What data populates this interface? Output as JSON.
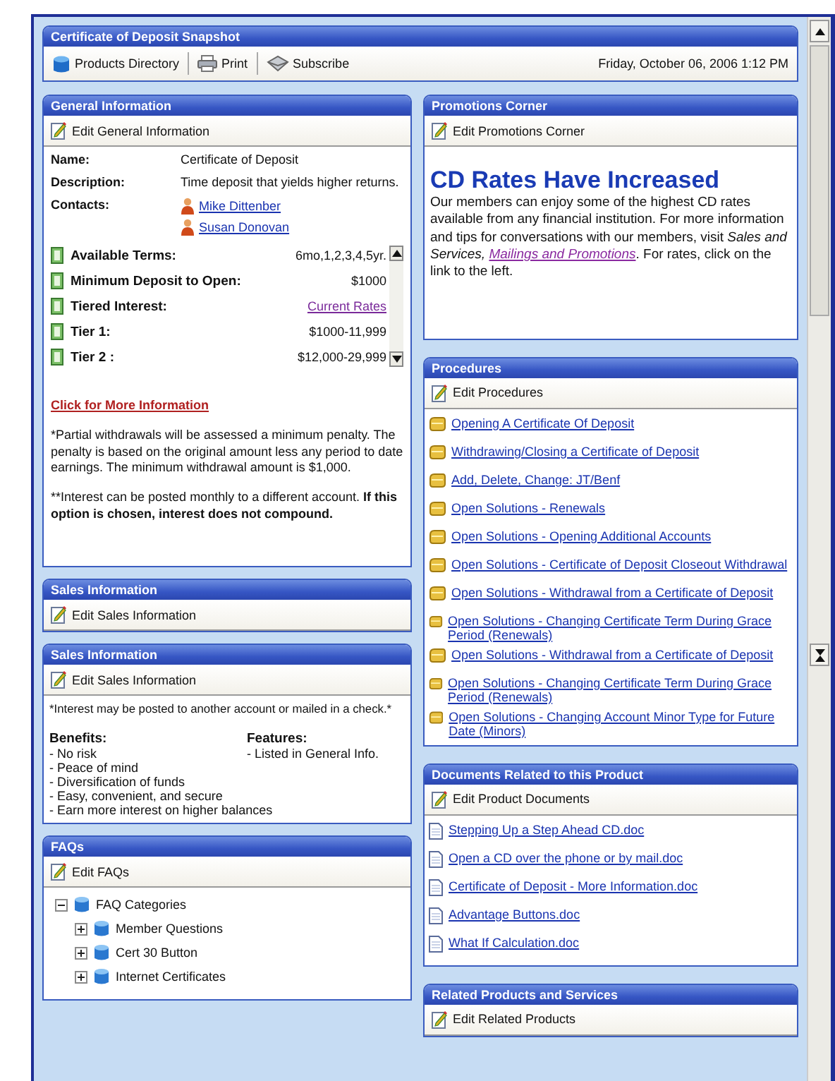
{
  "header": {
    "title": "Certificate of Deposit Snapshot",
    "toolbar": [
      {
        "kind": "directory",
        "label": "Products Directory"
      },
      {
        "kind": "print",
        "label": "Print"
      },
      {
        "kind": "subscribe",
        "label": "Subscribe"
      }
    ],
    "date": "Friday, October 06, 2006 1:12 PM"
  },
  "left_column": [
    {
      "kind": "general",
      "title": "General Information",
      "edit_label": "Edit General Information",
      "fields": [
        {
          "label": "Name:",
          "value": "Certificate of Deposit"
        },
        {
          "label": "Description:",
          "value": "Time deposit that yields higher returns."
        }
      ],
      "contacts_label": "Contacts:",
      "contacts": [
        "Mike Dittenber",
        "Susan Donovan"
      ],
      "terms": [
        {
          "kind": "text",
          "label": "Available Terms:",
          "value": "6mo,1,2,3,4,5yr."
        },
        {
          "kind": "text",
          "label": "Minimum Deposit to Open:",
          "value": "$1000"
        },
        {
          "kind": "link",
          "label": "Tiered Interest:",
          "value": "Current Rates"
        },
        {
          "kind": "text",
          "label": "Tier 1:",
          "value": "$1000-11,999"
        },
        {
          "kind": "text",
          "label": "Tier 2 :",
          "value": "$12,000-29,999"
        }
      ],
      "more_link": "Click for More Information",
      "note": "*Partial withdrawals will be assessed a minimum penalty.  The penalty is based on the original amount less any period to date earnings. The minimum withdrawal amount is $1,000.",
      "note2": {
        "text": "**Interest can be posted monthly to a different account.",
        "emphasis": "If this option is chosen, interest does not compound."
      }
    },
    {
      "kind": "empty",
      "title": "Sales Information",
      "edit_label": "Edit Sales Information"
    },
    {
      "kind": "sales",
      "title": "Sales Information",
      "edit_label": "Edit Sales Information",
      "note": "*Interest may be posted to another account or mailed in a check.*",
      "lists": [
        {
          "heading": "Benefits:",
          "items": [
            "- No risk",
            "- Peace of mind",
            "- Diversification of funds",
            "- Easy, convenient, and secure",
            "- Earn more interest on higher balances"
          ]
        },
        {
          "heading": "Features:",
          "items": [
            "- Listed in General Info."
          ]
        }
      ]
    },
    {
      "kind": "tree",
      "title": "FAQs",
      "edit_label": "Edit FAQs",
      "tree": {
        "label": "FAQ Categories",
        "expanded": true,
        "children": [
          {
            "label": "Member Questions",
            "expanded": false
          },
          {
            "label": "Cert 30 Button",
            "expanded": false
          },
          {
            "label": "Internet Certificates",
            "expanded": false
          }
        ]
      }
    }
  ],
  "right_column": [
    {
      "kind": "promo",
      "title": "Promotions Corner",
      "edit_label": "Edit Promotions Corner",
      "heading": "CD Rates Have Increased",
      "text_before": "Our members can enjoy some of the highest CD rates available from any financial institution. For more information and tips for conversations with our members, visit *Sales and Services,*",
      "link": "Mailings and Promotions",
      "text_after": ". For rates, click on the link to the left."
    },
    {
      "kind": "procedures",
      "title": "Procedures",
      "edit_label": "Edit Procedures",
      "links": [
        "Opening A Certificate Of Deposit",
        "Withdrawing/Closing a Certificate of Deposit",
        "Add, Delete, Change: JT/Benf",
        "Open Solutions - Renewals",
        "Open Solutions - Opening Additional Accounts",
        "Open Solutions - Certificate of Deposit Closeout Withdrawal",
        "Open Solutions - Withdrawal from a Certificate of Deposit",
        "Open Solutions - Changing Certificate Term During Grace Period (Renewals)",
        "Open Solutions - Withdrawal from a Certificate of Deposit",
        "Open Solutions - Changing Certificate Term During Grace Period (Renewals)",
        "Open Solutions - Changing Account Minor Type for Future Date (Minors)"
      ]
    },
    {
      "kind": "documents",
      "title": "Documents Related to this Product",
      "edit_label": "Edit Product Documents",
      "links": [
        "Stepping Up a Step Ahead CD.doc",
        "Open a CD over the phone or by mail.doc",
        "Certificate of Deposit - More Information.doc",
        "Advantage Buttons.doc",
        "What If Calculation.doc"
      ]
    },
    {
      "kind": "empty",
      "title": "Related Products and Services",
      "edit_label": "Edit Related Products"
    }
  ]
}
